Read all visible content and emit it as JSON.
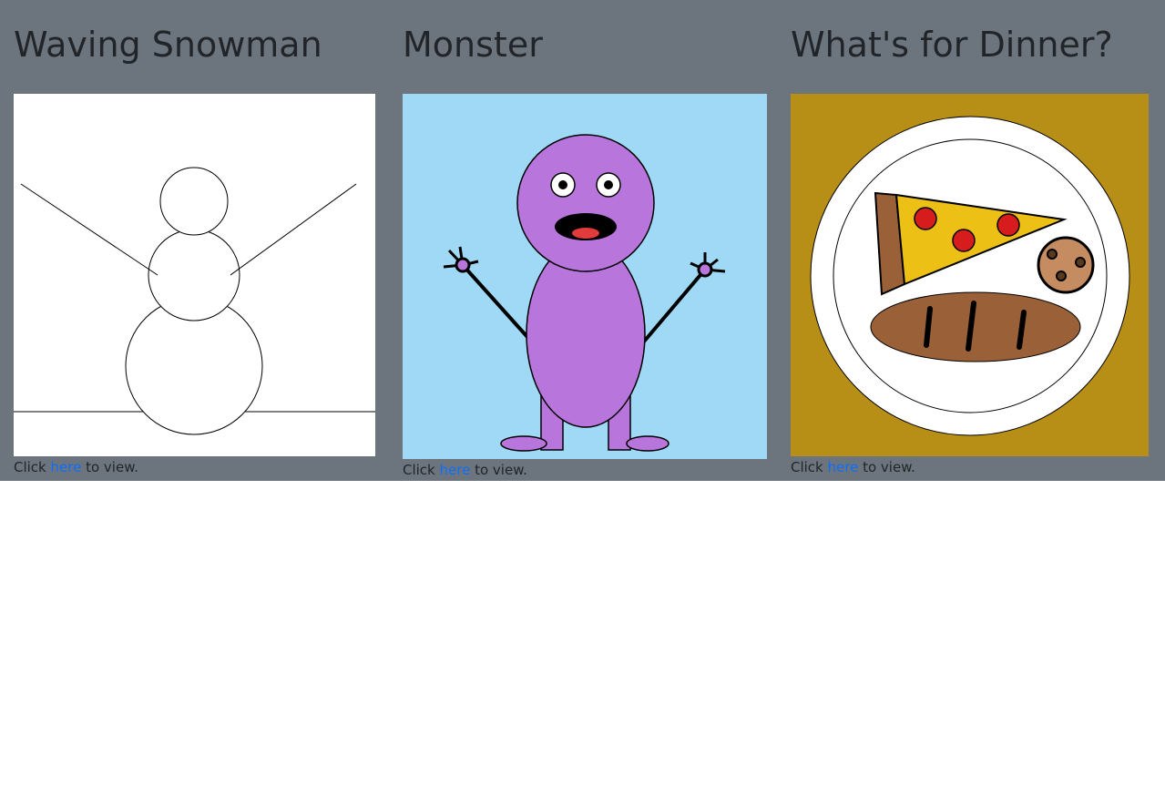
{
  "cards": [
    {
      "title": "Waving Snowman",
      "caption_prefix": "Click ",
      "link_text": "here",
      "caption_suffix": " to view.",
      "canvas_bg": "#ffffff"
    },
    {
      "title": "Monster",
      "caption_prefix": "Click ",
      "link_text": "here",
      "caption_suffix": " to view.",
      "canvas_bg": "#a0d9f5",
      "body_color": "#b876dc"
    },
    {
      "title": "What's for Dinner?",
      "caption_prefix": "Click ",
      "link_text": "here",
      "caption_suffix": " to view.",
      "canvas_bg": "#b88f16",
      "pizza_color": "#ecc014",
      "pepperoni_color": "#d61c1c",
      "crust_color": "#9a6037",
      "cookie_color": "#c48c60"
    }
  ],
  "colors": {
    "page_band": "#6c757d",
    "link": "#0d6efd",
    "text": "#212529"
  }
}
